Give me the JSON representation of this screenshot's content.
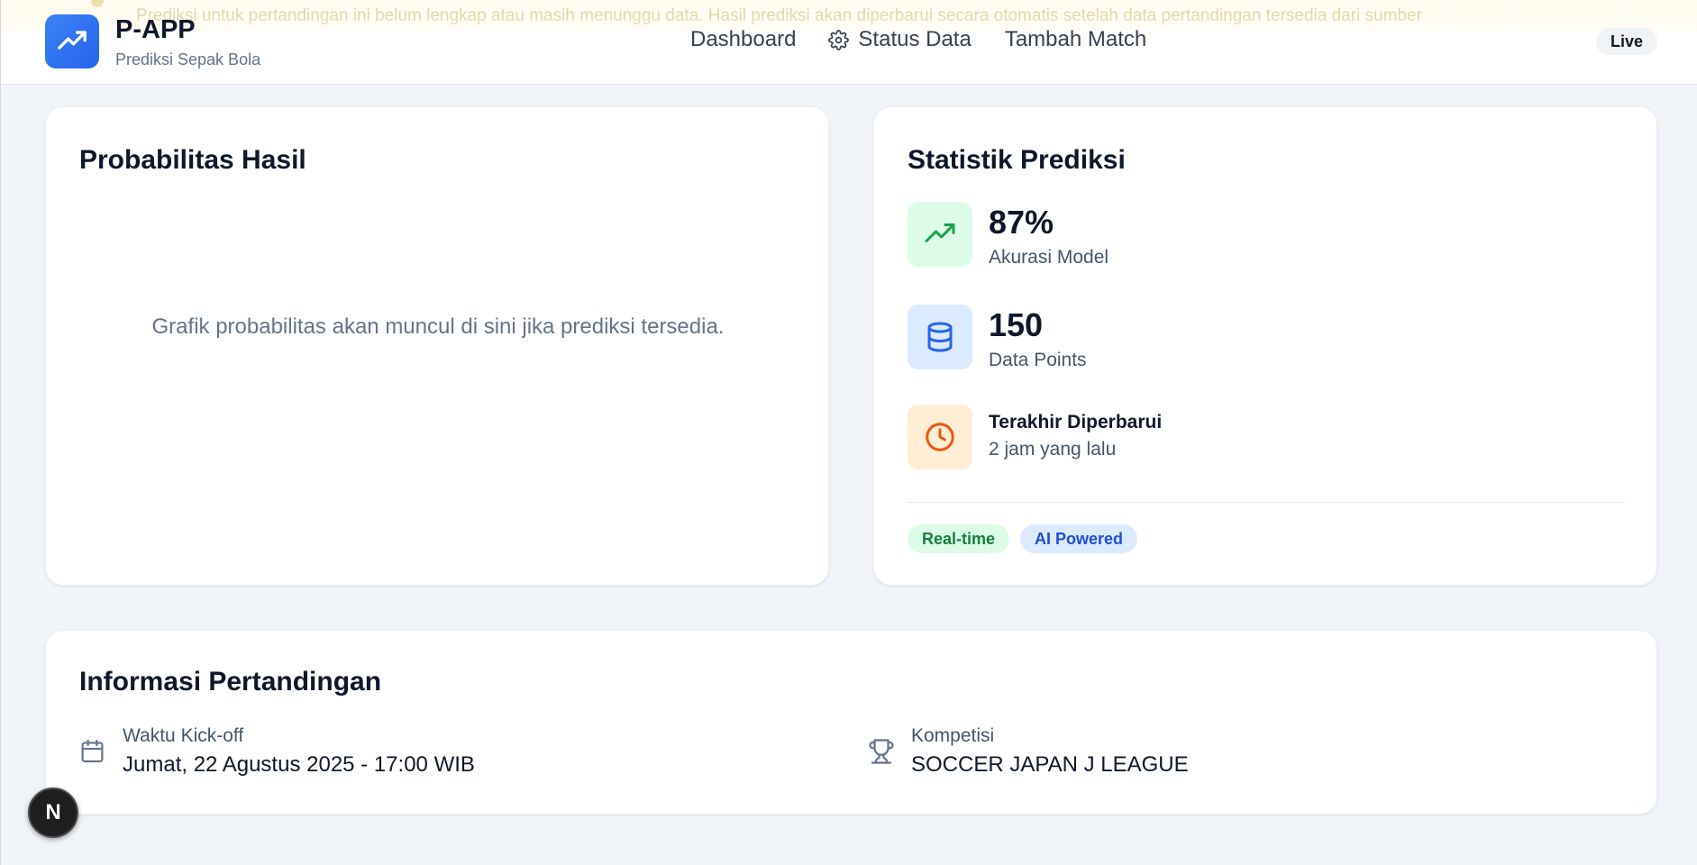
{
  "header": {
    "app_name": "P-APP",
    "app_subtitle": "Prediksi Sepak Bola",
    "alert_text": "Prediksi untuk pertandingan ini belum lengkap atau masih menunggu data. Hasil prediksi akan diperbarui secara otomatis setelah data pertandingan tersedia dari sumber",
    "nav": {
      "dashboard": "Dashboard",
      "status_data": "Status Data",
      "add_match": "Tambah Match"
    },
    "live_badge": "Live"
  },
  "probability_card": {
    "title": "Probabilitas Hasil",
    "empty_message": "Grafik probabilitas akan muncul di sini jika prediksi tersedia."
  },
  "stats_card": {
    "title": "Statistik Prediksi",
    "accuracy": {
      "value": "87%",
      "label": "Akurasi Model",
      "icon": "trending-up-icon"
    },
    "data_points": {
      "value": "150",
      "label": "Data Points",
      "icon": "database-icon"
    },
    "last_updated": {
      "title": "Terakhir Diperbarui",
      "value": "2 jam yang lalu",
      "icon": "clock-icon"
    },
    "tags": [
      "Real-time",
      "AI Powered"
    ]
  },
  "match_info": {
    "title": "Informasi Pertandingan",
    "kickoff": {
      "label": "Waktu Kick-off",
      "value": "Jumat, 22 Agustus 2025 - 17:00 WIB",
      "icon": "calendar-icon"
    },
    "competition": {
      "label": "Kompetisi",
      "value": "SOCCER JAPAN J LEAGUE",
      "icon": "trophy-icon"
    }
  },
  "fab": {
    "label": "N"
  },
  "colors": {
    "brand": "#2563eb",
    "green_bg": "#dcfce7",
    "green": "#16a34a",
    "blue_bg": "#dbeafe",
    "blue": "#2563eb",
    "orange_bg": "#ffedd5",
    "orange": "#ea580c",
    "background": "#f1f4f8"
  }
}
